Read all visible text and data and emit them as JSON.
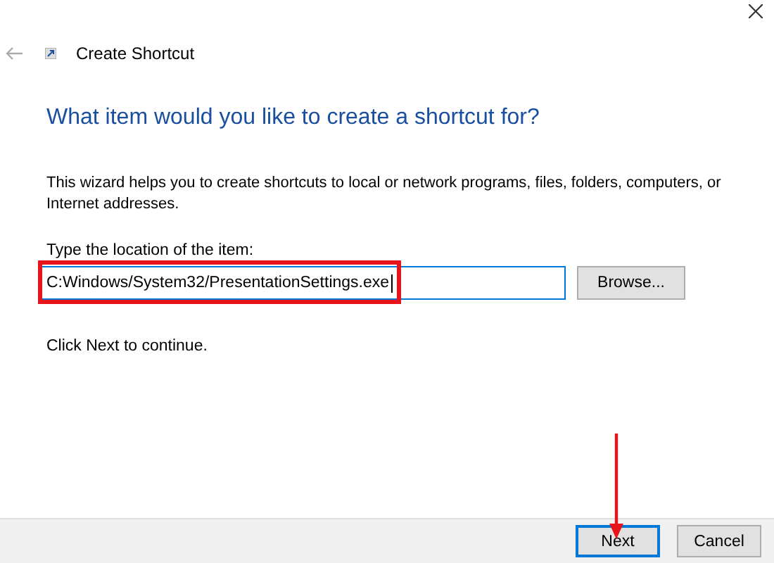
{
  "window": {
    "title": "Create Shortcut"
  },
  "heading": "What item would you like to create a shortcut for?",
  "description": "This wizard helps you to create shortcuts to local or network programs, files, folders, computers, or Internet addresses.",
  "location": {
    "label": "Type the location of the item:",
    "value": "C:Windows/System32/PresentationSettings.exe",
    "focused": true,
    "highlighted": true
  },
  "browse_button": "Browse...",
  "hint": "Click Next to continue.",
  "buttons": [
    {
      "label": "Next",
      "default": true,
      "pointed_at": true
    },
    {
      "label": "Cancel",
      "default": false,
      "pointed_at": false
    }
  ]
}
